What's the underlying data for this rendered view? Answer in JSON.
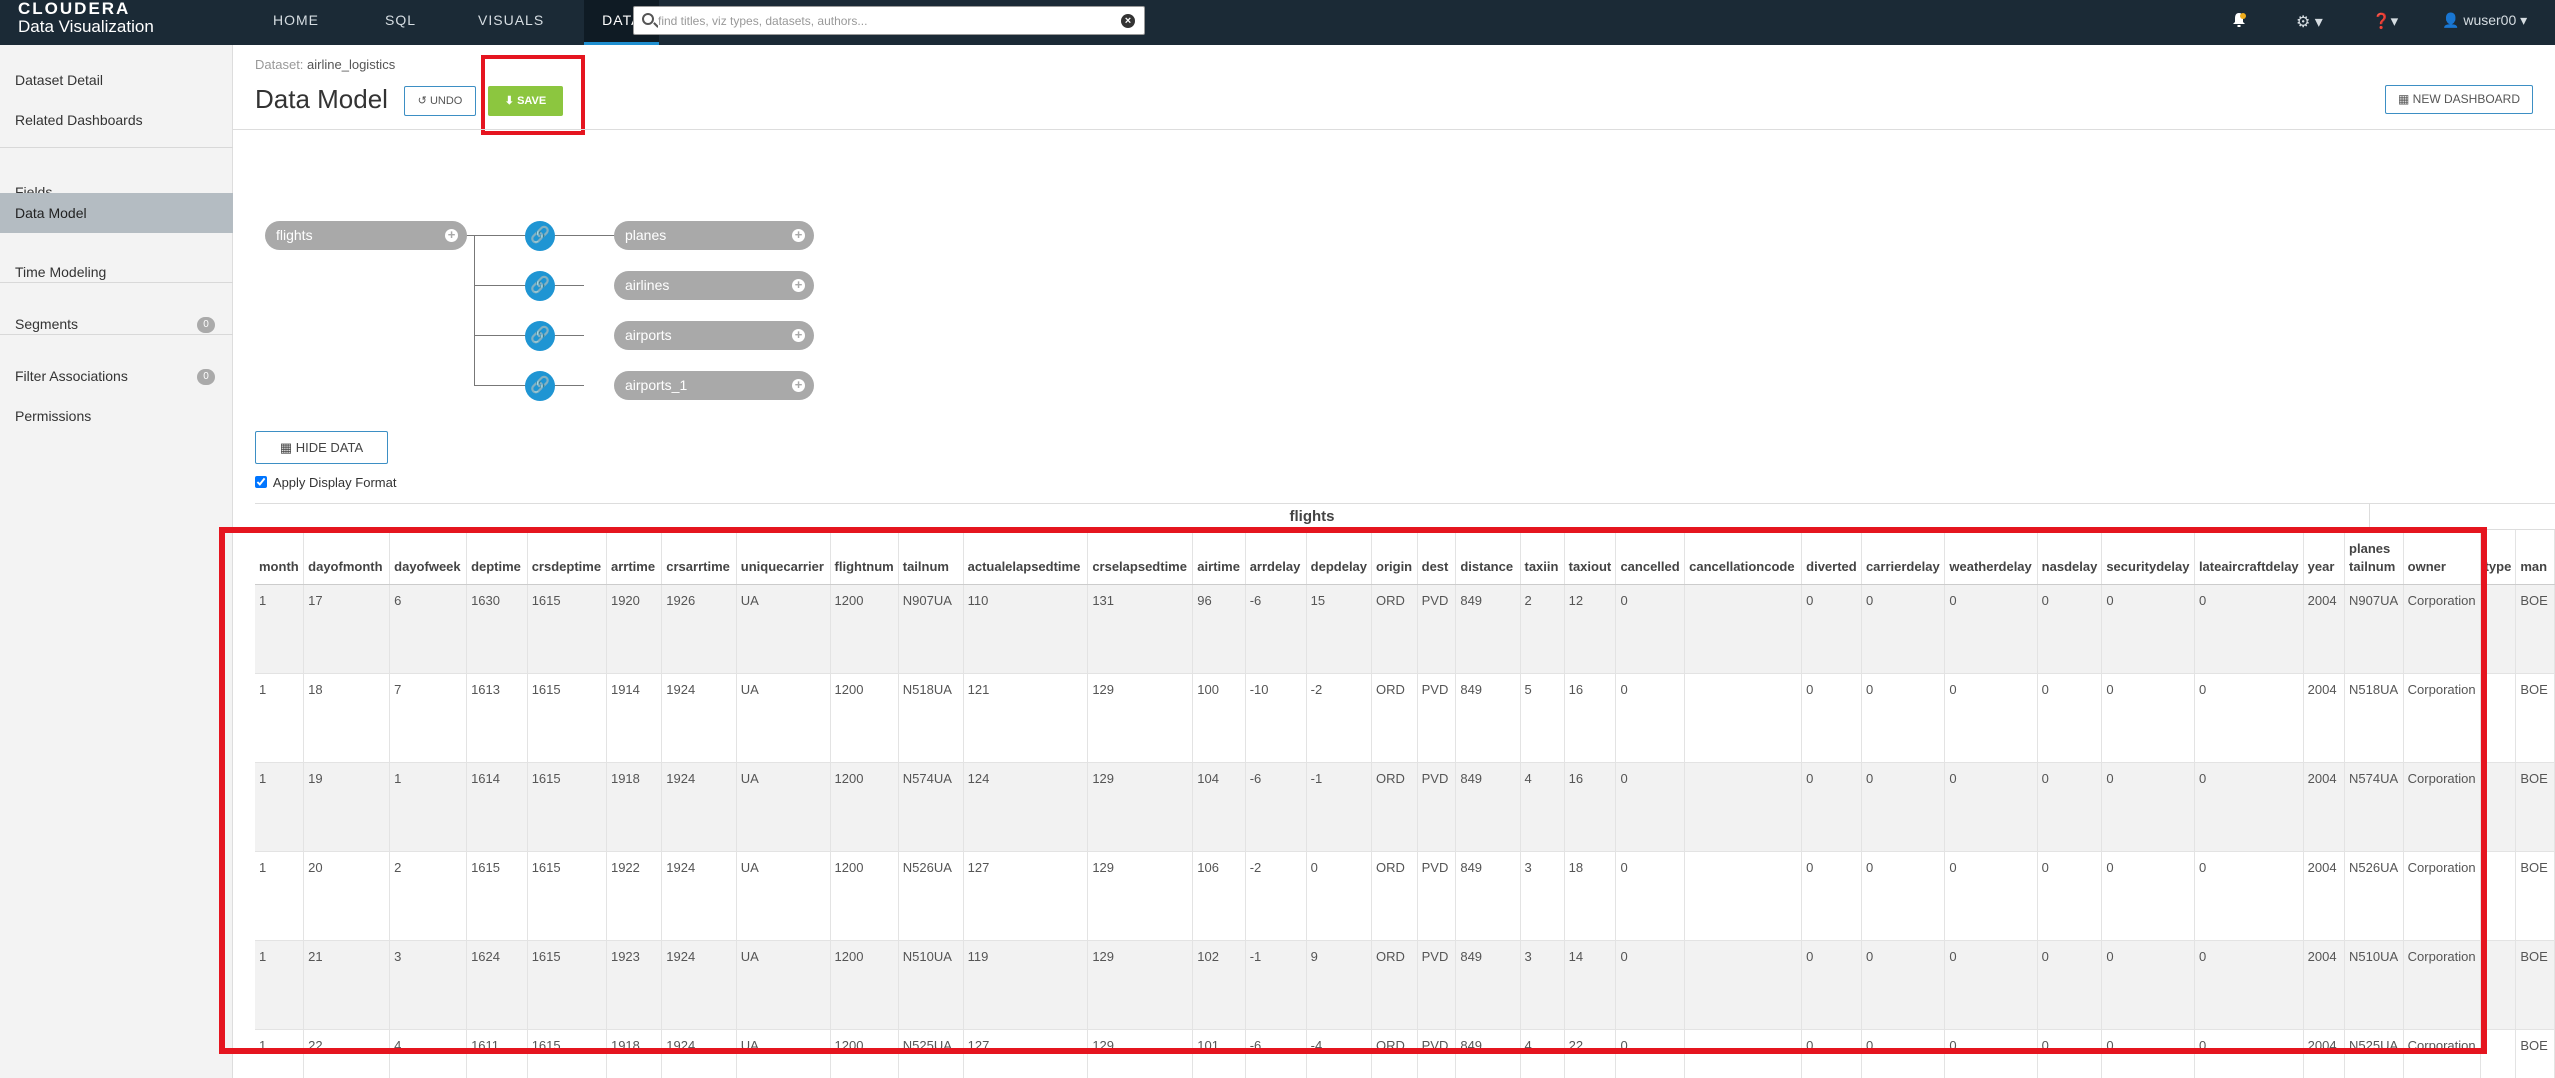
{
  "app": {
    "brand_top": "CLOUDERA",
    "brand_bottom": "Data Visualization"
  },
  "nav": {
    "home": "HOME",
    "sql": "SQL",
    "visuals": "VISUALS",
    "data": "DATA"
  },
  "search": {
    "placeholder": "find titles, viz types, datasets, authors..."
  },
  "user": {
    "name": "wuser00"
  },
  "sidebar": {
    "items": [
      {
        "label": "Dataset Detail"
      },
      {
        "label": "Related Dashboards"
      },
      {
        "label": "Fields"
      },
      {
        "label": "Data Model"
      },
      {
        "label": "Time Modeling"
      },
      {
        "label": "Segments",
        "badge": "0"
      },
      {
        "label": "Filter Associations",
        "badge": "0"
      },
      {
        "label": "Permissions"
      }
    ]
  },
  "header": {
    "dataset_prefix": "Dataset:",
    "dataset_name": "airline_logistics",
    "title": "Data Model",
    "undo": "UNDO",
    "save": "SAVE",
    "new_dashboard": "NEW DASHBOARD"
  },
  "diagram": {
    "root": "flights",
    "joins": [
      "planes",
      "airlines",
      "airports",
      "airports_1"
    ]
  },
  "controls": {
    "hide_data": "HIDE DATA",
    "apply_display_format": "Apply Display Format"
  },
  "table": {
    "caption": "flights",
    "columns": [
      "month",
      "dayofmonth",
      "dayofweek",
      "deptime",
      "crsdeptime",
      "arrtime",
      "crsarrtime",
      "uniquecarrier",
      "flightnum",
      "tailnum",
      "actualelapsedtime",
      "crselapsedtime",
      "airtime",
      "arrdelay",
      "depdelay",
      "origin",
      "dest",
      "distance",
      "taxiin",
      "taxiout",
      "cancelled",
      "cancellationcode",
      "diverted",
      "carrierdelay",
      "weatherdelay",
      "nasdelay",
      "securitydelay",
      "lateaircraftdelay",
      "year",
      "planes tailnum",
      "owner",
      "type",
      "man"
    ],
    "rows": [
      [
        "1",
        "17",
        "6",
        "1630",
        "1615",
        "1920",
        "1926",
        "UA",
        "1200",
        "N907UA",
        "110",
        "131",
        "96",
        "-6",
        "15",
        "ORD",
        "PVD",
        "849",
        "2",
        "12",
        "0",
        "",
        "0",
        "0",
        "0",
        "0",
        "0",
        "0",
        "2004",
        "N907UA",
        "Corporation",
        "",
        "BOE"
      ],
      [
        "1",
        "18",
        "7",
        "1613",
        "1615",
        "1914",
        "1924",
        "UA",
        "1200",
        "N518UA",
        "121",
        "129",
        "100",
        "-10",
        "-2",
        "ORD",
        "PVD",
        "849",
        "5",
        "16",
        "0",
        "",
        "0",
        "0",
        "0",
        "0",
        "0",
        "0",
        "2004",
        "N518UA",
        "Corporation",
        "",
        "BOE"
      ],
      [
        "1",
        "19",
        "1",
        "1614",
        "1615",
        "1918",
        "1924",
        "UA",
        "1200",
        "N574UA",
        "124",
        "129",
        "104",
        "-6",
        "-1",
        "ORD",
        "PVD",
        "849",
        "4",
        "16",
        "0",
        "",
        "0",
        "0",
        "0",
        "0",
        "0",
        "0",
        "2004",
        "N574UA",
        "Corporation",
        "",
        "BOE"
      ],
      [
        "1",
        "20",
        "2",
        "1615",
        "1615",
        "1922",
        "1924",
        "UA",
        "1200",
        "N526UA",
        "127",
        "129",
        "106",
        "-2",
        "0",
        "ORD",
        "PVD",
        "849",
        "3",
        "18",
        "0",
        "",
        "0",
        "0",
        "0",
        "0",
        "0",
        "0",
        "2004",
        "N526UA",
        "Corporation",
        "",
        "BOE"
      ],
      [
        "1",
        "21",
        "3",
        "1624",
        "1615",
        "1923",
        "1924",
        "UA",
        "1200",
        "N510UA",
        "119",
        "129",
        "102",
        "-1",
        "9",
        "ORD",
        "PVD",
        "849",
        "3",
        "14",
        "0",
        "",
        "0",
        "0",
        "0",
        "0",
        "0",
        "0",
        "2004",
        "N510UA",
        "Corporation",
        "",
        "BOE"
      ],
      [
        "1",
        "22",
        "4",
        "1611",
        "1615",
        "1918",
        "1924",
        "UA",
        "1200",
        "N525UA",
        "127",
        "129",
        "101",
        "-6",
        "-4",
        "ORD",
        "PVD",
        "849",
        "4",
        "22",
        "0",
        "",
        "0",
        "0",
        "0",
        "0",
        "0",
        "0",
        "2004",
        "N525UA",
        "Corporation",
        "",
        "BOE"
      ]
    ]
  }
}
